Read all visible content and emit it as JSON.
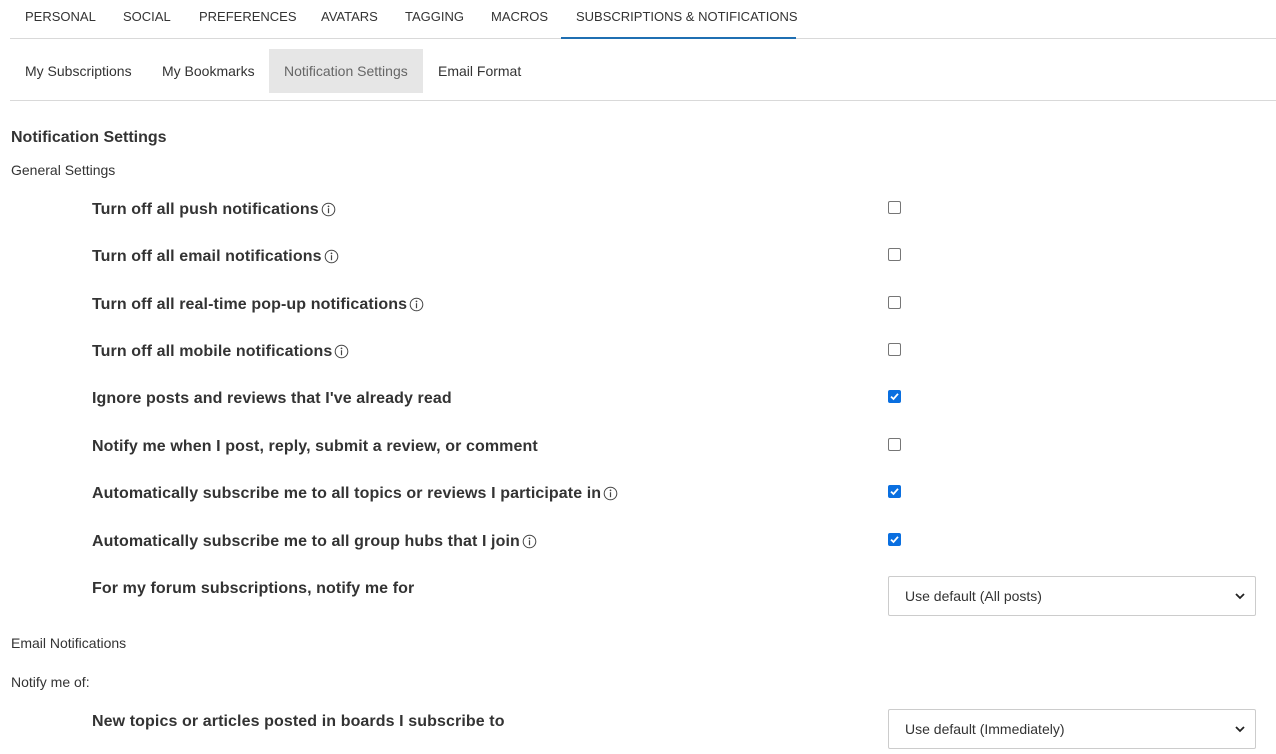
{
  "top_tabs": [
    {
      "label": "PERSONAL"
    },
    {
      "label": "SOCIAL"
    },
    {
      "label": "PREFERENCES"
    },
    {
      "label": "AVATARS"
    },
    {
      "label": "TAGGING"
    },
    {
      "label": "MACROS"
    },
    {
      "label": "SUBSCRIPTIONS & NOTIFICATIONS"
    }
  ],
  "sub_tabs": [
    {
      "label": "My Subscriptions"
    },
    {
      "label": "My Bookmarks"
    },
    {
      "label": "Notification Settings"
    },
    {
      "label": "Email Format"
    }
  ],
  "page_title": "Notification Settings",
  "general_label": "General Settings",
  "settings": [
    {
      "label": "Turn off all push notifications",
      "checked": false,
      "info": true
    },
    {
      "label": "Turn off all email notifications",
      "checked": false,
      "info": true
    },
    {
      "label": "Turn off all real-time pop-up notifications",
      "checked": false,
      "info": true
    },
    {
      "label": "Turn off all mobile notifications",
      "checked": false,
      "info": true
    },
    {
      "label": "Ignore posts and reviews that I've already read",
      "checked": true,
      "info": false
    },
    {
      "label": "Notify me when I post, reply, submit a review, or comment",
      "checked": false,
      "info": false
    },
    {
      "label": "Automatically subscribe me to all topics or reviews I participate in",
      "checked": true,
      "info": true
    },
    {
      "label": "Automatically subscribe me to all group hubs that I join",
      "checked": true,
      "info": true
    }
  ],
  "forum_setting": {
    "label": "For my forum subscriptions, notify me for",
    "value": "Use default (All posts)"
  },
  "email_notifications_label": "Email Notifications",
  "notify_me_of_label": "Notify me of:",
  "new_topics_setting": {
    "label": "New topics or articles posted in boards I subscribe to",
    "value": "Use default (Immediately)"
  },
  "colors": {
    "accent": "#1f6fb2",
    "checkbox": "#0a6fe0"
  }
}
